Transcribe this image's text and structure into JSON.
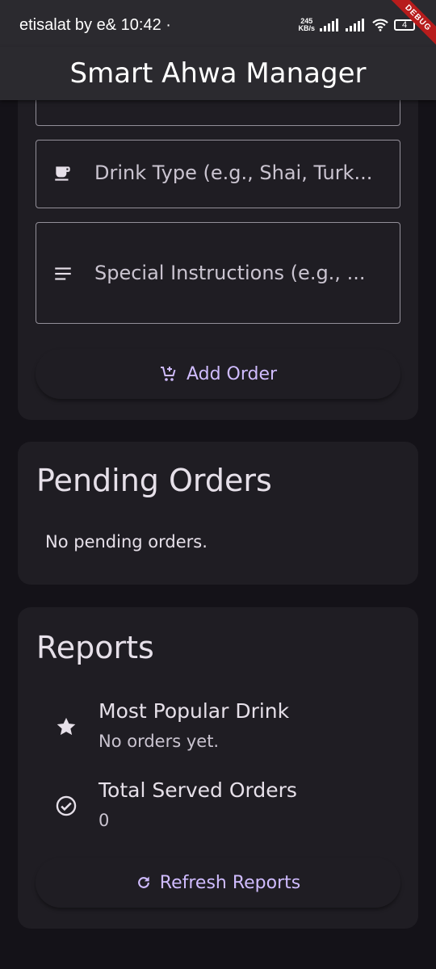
{
  "status_bar": {
    "carrier": "etisalat by e&",
    "time": "10:42",
    "dot": "·",
    "speed_value": "245",
    "speed_unit": "KB/s",
    "battery": "4",
    "icons": [
      "signal-icon",
      "signal-icon",
      "wifi-icon",
      "battery-icon"
    ]
  },
  "debug_banner": "DEBUG",
  "app_bar": {
    "title": "Smart Ahwa Manager"
  },
  "order_form": {
    "drink_type": {
      "placeholder": "Drink Type (e.g., Shai, Turk...",
      "icon": "coffee-icon"
    },
    "instructions": {
      "placeholder": "Special Instructions (e.g., ...",
      "icon": "notes-icon"
    },
    "add_button": {
      "label": "Add Order",
      "icon": "add-cart-icon"
    }
  },
  "pending": {
    "title": "Pending Orders",
    "empty_text": "No pending orders."
  },
  "reports": {
    "title": "Reports",
    "items": [
      {
        "title": "Most Popular Drink",
        "value": "No orders yet.",
        "icon": "star-icon"
      },
      {
        "title": "Total Served Orders",
        "value": "0",
        "icon": "check-circle-icon"
      }
    ],
    "refresh_button": {
      "label": "Refresh Reports",
      "icon": "refresh-icon"
    }
  },
  "colors": {
    "background": "#141218",
    "surface": "#1f1d23",
    "app_bar": "#2b2a2f",
    "accent": "#d0bcff",
    "outline": "#938f99",
    "debug": "#b71c1c"
  }
}
